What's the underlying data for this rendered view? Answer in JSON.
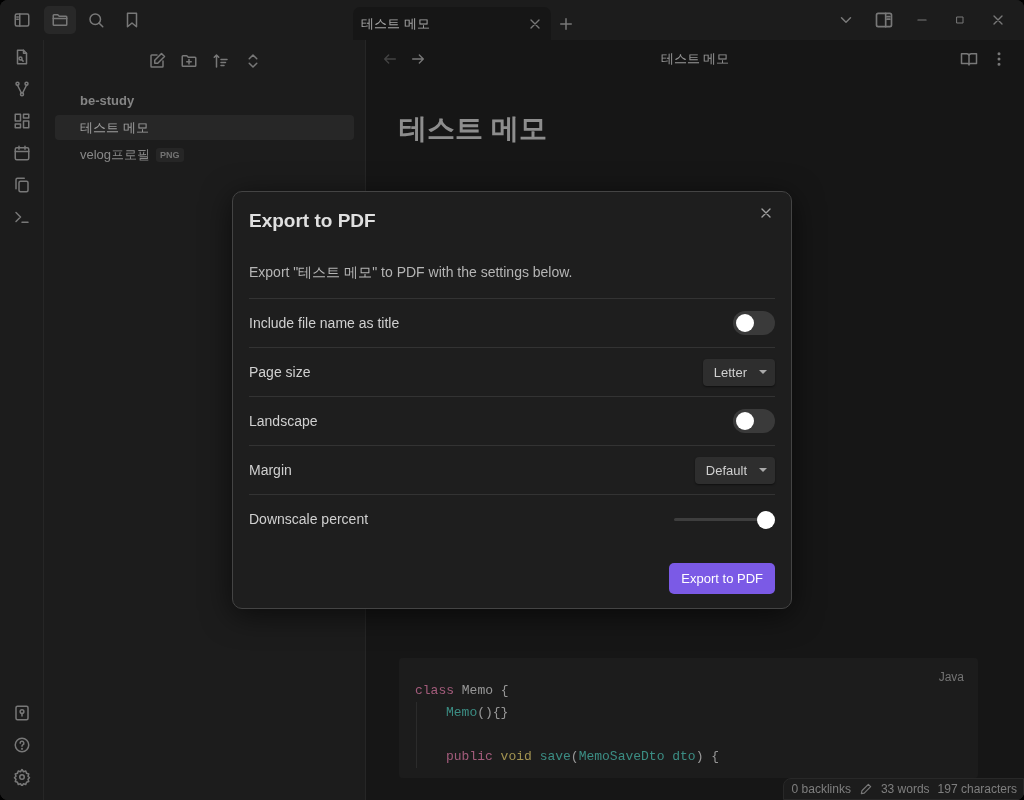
{
  "tabs": [
    {
      "label": "테스트 메모",
      "selected": true
    }
  ],
  "sidebar": {
    "items": [
      {
        "label": "be-study",
        "kind": "folder",
        "selected": false
      },
      {
        "label": "테스트 메모",
        "kind": "file",
        "selected": true
      },
      {
        "label": "velog프로필",
        "kind": "file",
        "badge": "PNG",
        "selected": false
      }
    ]
  },
  "view_header": {
    "title": "테스트 메모"
  },
  "document": {
    "title": "테스트 메모",
    "code_block": {
      "language": "Java",
      "lines": [
        {
          "tokens": [
            {
              "text": "class",
              "kind": "keyword"
            },
            {
              "text": " Memo {",
              "kind": "plain"
            }
          ],
          "children": [
            {
              "tokens": [
                {
                  "text": "Memo",
                  "kind": "func"
                },
                {
                  "text": "(){}",
                  "kind": "plain"
                }
              ]
            },
            {
              "kind": "blank"
            },
            {
              "tokens": [
                {
                  "text": "public",
                  "kind": "keyword"
                },
                {
                  "text": " void",
                  "kind": "type"
                },
                {
                  "text": " save",
                  "kind": "func"
                },
                {
                  "text": "(",
                  "kind": "plain"
                },
                {
                  "text": "MemoSaveDto dto",
                  "kind": "func"
                },
                {
                  "text": ") {",
                  "kind": "plain"
                }
              ]
            }
          ]
        }
      ]
    }
  },
  "dialog": {
    "title": "Export to PDF",
    "description": "Export \"테스트 메모\" to PDF with the settings below.",
    "settings": [
      {
        "label": "Include file name as title",
        "kind": "toggle",
        "on": false
      },
      {
        "label": "Page size",
        "kind": "dropdown",
        "value": "Letter"
      },
      {
        "label": "Landscape",
        "kind": "toggle",
        "on": false
      },
      {
        "label": "Margin",
        "kind": "dropdown",
        "value": "Default"
      },
      {
        "label": "Downscale percent",
        "kind": "slider",
        "level": 1.0
      }
    ],
    "button": "Export to PDF"
  },
  "status_bar": {
    "backlinks": "0 backlinks",
    "words": "33 words",
    "characters": "197 characters"
  }
}
